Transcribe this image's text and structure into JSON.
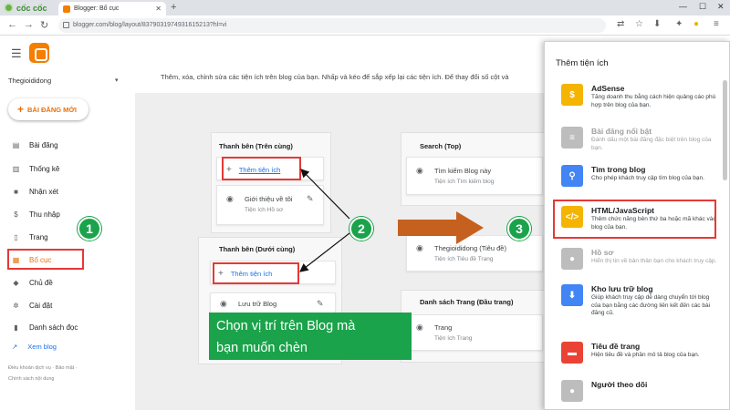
{
  "browser": {
    "brand": "cốc cốc",
    "tab_title": "Blogger: Bố cục",
    "url": "blogger.com/blog/layout/8379031974931615213?hl=vi"
  },
  "sidebar": {
    "blog_name": "Thegioididong",
    "new_post": "BÀI ĐĂNG MỚI",
    "items": [
      {
        "label": "Bài đăng",
        "icon": "posts-icon"
      },
      {
        "label": "Thống kê",
        "icon": "stats-icon"
      },
      {
        "label": "Nhận xét",
        "icon": "comments-icon"
      },
      {
        "label": "Thu nhập",
        "icon": "earnings-icon"
      },
      {
        "label": "Trang",
        "icon": "pages-icon"
      },
      {
        "label": "Bố cục",
        "icon": "layout-icon"
      },
      {
        "label": "Chủ đề",
        "icon": "theme-icon"
      },
      {
        "label": "Cài đặt",
        "icon": "settings-icon"
      },
      {
        "label": "Danh sách đọc",
        "icon": "reading-list-icon"
      }
    ],
    "view_blog": "Xem blog",
    "footer_line1": "Điều khoản dịch vụ · Bảo mật ·",
    "footer_line2": "Chính sách nội dung"
  },
  "main": {
    "description": "Thêm, xóa, chỉnh sửa các tiện ích trên blog của bạn. Nhấp và kéo để sắp xếp lại các tiện ích. Để thay đổi số cột và",
    "sections": {
      "sidebar_top": {
        "title": "Thanh bên (Trên cùng)",
        "add": "Thêm tiện ích",
        "gadget_title": "Giới thiệu về tôi",
        "gadget_sub": "Tiện ích Hồ sơ"
      },
      "sidebar_bottom": {
        "title": "Thanh bên (Dưới cùng)",
        "add": "Thêm tiện ích",
        "gadget_title": "Lưu trữ Blog"
      },
      "search_top": {
        "title": "Search (Top)",
        "gadget_title": "Tìm kiếm Blog này",
        "gadget_sub": "Tiện ích Tìm kiếm blog"
      },
      "header": {
        "gadget_title": "Thegioididong (Tiêu đề)",
        "gadget_sub": "Tiện ích Tiêu đề Trang"
      },
      "page_list": {
        "title": "Danh sách Trang (Đầu trang)",
        "gadget_title": "Trang",
        "gadget_sub": "Tiện ích Trang"
      }
    }
  },
  "callouts": {
    "step1": "1",
    "step2": "2",
    "step3": "3",
    "banner_line1": "Chọn vị trí trên Blog mà",
    "banner_line2": "bạn muốn chèn"
  },
  "panel": {
    "title": "Thêm tiện ích",
    "items": [
      {
        "name": "AdSense",
        "desc": "Tăng doanh thu bằng cách hiện quảng cáo phù hợp trên blog của bạn.",
        "color": "#f4b400"
      },
      {
        "name": "Bài đăng nổi bật",
        "desc": "Đánh dấu một bài đăng đặc biệt trên blog của bạn.",
        "color": "#bdbdbd"
      },
      {
        "name": "Tìm trong blog",
        "desc": "Cho phép khách truy cập tìm blog của bạn.",
        "color": "#4285f4"
      },
      {
        "name": "HTML/JavaScript",
        "desc": "Thêm chức năng bên thứ ba hoặc mã khác vào blog của bạn.",
        "color": "#f4b400"
      },
      {
        "name": "Hồ sơ",
        "desc": "Hiển thị tin về bản thân bạn cho khách truy cập.",
        "color": "#bdbdbd"
      },
      {
        "name": "Kho lưu trữ blog",
        "desc": "Giúp khách truy cập dễ dàng chuyển tới blog của bạn bằng các đường liên kết đến các bài đăng cũ.",
        "color": "#4285f4"
      },
      {
        "name": "Tiêu đề trang",
        "desc": "Hiện tiêu đề và phần mô tả blog của bạn.",
        "color": "#ea4335"
      },
      {
        "name": "Người theo dõi",
        "desc": "",
        "color": "#bdbdbd"
      }
    ]
  }
}
